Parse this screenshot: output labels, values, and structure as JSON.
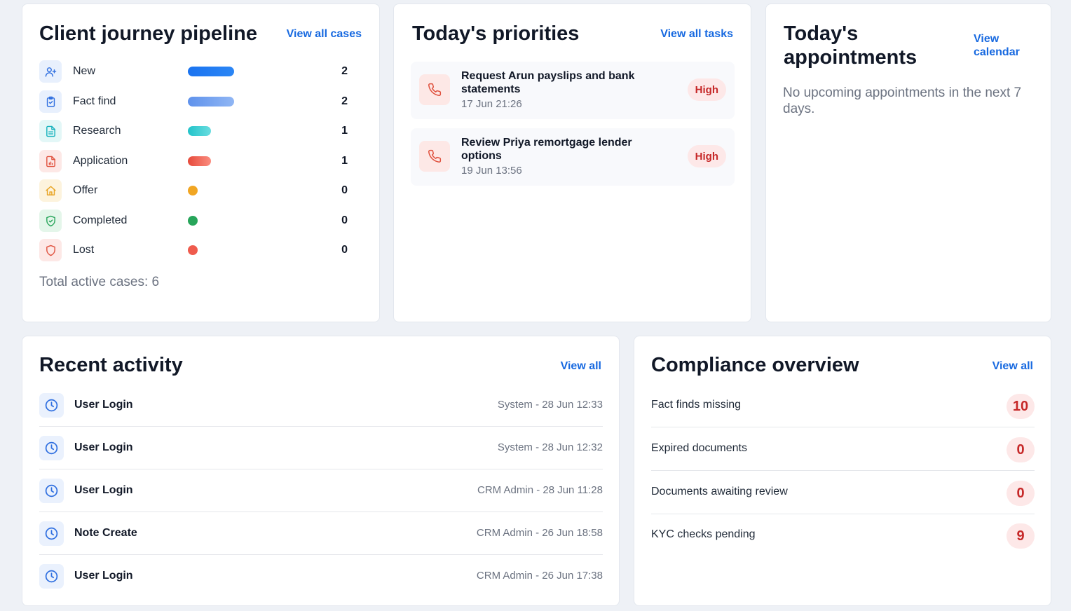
{
  "pipeline": {
    "title": "Client journey pipeline",
    "link": "View all cases",
    "total": "Total active cases: 6",
    "max": 2,
    "stages": [
      {
        "label": "New",
        "count": "2",
        "value": 2,
        "icon": "user-plus-icon",
        "icon_bg": "#e8f0fd",
        "icon_color": "#2f6fe0",
        "bar": [
          "#1a73f0",
          "#2b86f5"
        ]
      },
      {
        "label": "Fact find",
        "count": "2",
        "value": 2,
        "icon": "clipboard-check-icon",
        "icon_bg": "#e8f0fd",
        "icon_color": "#2f6fe0",
        "bar": [
          "#5f92ec",
          "#90b6f4"
        ]
      },
      {
        "label": "Research",
        "count": "1",
        "value": 1,
        "icon": "document-text-icon",
        "icon_bg": "#e3f7f7",
        "icon_color": "#17b2bd",
        "bar": [
          "#22c3c9",
          "#6adde0"
        ]
      },
      {
        "label": "Application",
        "count": "1",
        "value": 1,
        "icon": "file-chart-icon",
        "icon_bg": "#fde8e6",
        "icon_color": "#e0523f",
        "bar": [
          "#e64a3b",
          "#fb8d80"
        ]
      },
      {
        "label": "Offer",
        "count": "0",
        "value": 0,
        "icon": "house-icon",
        "icon_bg": "#fdf3dd",
        "icon_color": "#e8a322",
        "bar": [
          "#f1a623",
          "#f1a623"
        ]
      },
      {
        "label": "Completed",
        "count": "0",
        "value": 0,
        "icon": "shield-check-icon",
        "icon_bg": "#e4f6ea",
        "icon_color": "#27a55a",
        "bar": [
          "#27a55a",
          "#27a55a"
        ]
      },
      {
        "label": "Lost",
        "count": "0",
        "value": 0,
        "icon": "shield-icon",
        "icon_bg": "#fde8e6",
        "icon_color": "#e0523f",
        "bar": [
          "#ef5b4d",
          "#ef5b4d"
        ]
      }
    ]
  },
  "priorities": {
    "title": "Today's priorities",
    "link": "View all tasks",
    "tasks": [
      {
        "title": "Request Arun payslips and bank statements",
        "time": "17 Jun 21:26",
        "badge": "High",
        "icon": "phone-icon"
      },
      {
        "title": "Review Priya remortgage lender options",
        "time": "19 Jun 13:56",
        "badge": "High",
        "icon": "phone-icon"
      }
    ]
  },
  "appointments": {
    "title_line1": "Today's",
    "title_line2": "appointments",
    "link_line1": "View",
    "link_line2": "calendar",
    "empty": "No upcoming appointments in the next 7 days."
  },
  "activity": {
    "title": "Recent activity",
    "link": "View all",
    "items": [
      {
        "title": "User Login",
        "meta": "System - 28 Jun 12:33",
        "icon": "clock-icon"
      },
      {
        "title": "User Login",
        "meta": "System - 28 Jun 12:32",
        "icon": "clock-icon"
      },
      {
        "title": "User Login",
        "meta": "CRM Admin - 28 Jun 11:28",
        "icon": "clock-icon"
      },
      {
        "title": "Note Create",
        "meta": "CRM Admin - 26 Jun 18:58",
        "icon": "clock-icon"
      },
      {
        "title": "User Login",
        "meta": "CRM Admin - 26 Jun 17:38",
        "icon": "clock-icon"
      }
    ]
  },
  "compliance": {
    "title": "Compliance overview",
    "link": "View all",
    "items": [
      {
        "label": "Fact finds missing",
        "value": "10"
      },
      {
        "label": "Expired documents",
        "value": "0"
      },
      {
        "label": "Documents awaiting review",
        "value": "0"
      },
      {
        "label": "KYC checks pending",
        "value": "9"
      }
    ]
  },
  "colors": {
    "accent": "#1769e0",
    "danger": "#c62828",
    "danger_bg": "#fde8e8"
  }
}
